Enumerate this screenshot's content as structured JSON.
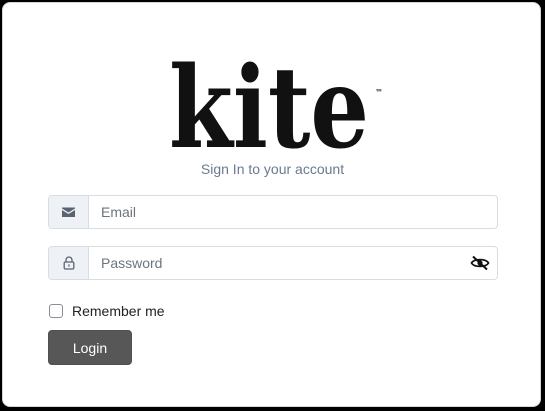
{
  "logo": {
    "text": "kite",
    "trademark": "™"
  },
  "form": {
    "subtitle": "Sign In to your account",
    "email": {
      "value": "",
      "placeholder": "Email",
      "icon": "envelope-icon"
    },
    "password": {
      "value": "",
      "placeholder": "Password",
      "icon": "lock-icon",
      "toggle_icon": "eye-slash-icon"
    },
    "remember_me": {
      "label": "Remember me",
      "checked": false
    },
    "login_label": "Login"
  },
  "colors": {
    "subtitle": "#6b7a90",
    "button_bg": "#575757",
    "addon_bg": "#eef1f5",
    "border": "#d8dde3"
  }
}
